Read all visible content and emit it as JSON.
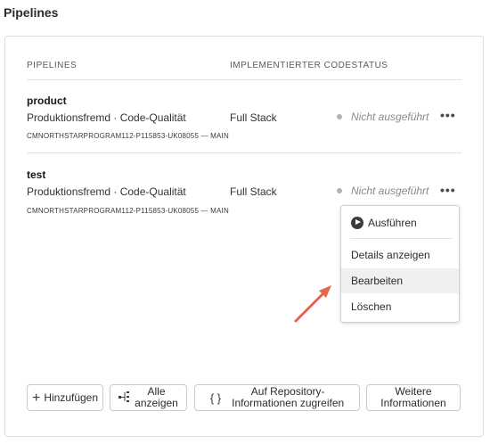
{
  "page": {
    "title": "Pipelines"
  },
  "table": {
    "headers": [
      "PIPELINES",
      "IMPLEMENTIERTER CODESTATUS"
    ],
    "rows": [
      {
        "name": "product",
        "type": "Produktionsfremd · Code-Qualität",
        "repo": "CMNORTHSTARPROGRAM112-P115853-UK08055 — MAIN",
        "stack": "Full Stack",
        "status": "Nicht ausgeführt",
        "more": "•••"
      },
      {
        "name": "test",
        "type": "Produktionsfremd · Code-Qualität",
        "repo": "CMNORTHSTARPROGRAM112-P115853-UK08055 — MAIN",
        "stack": "Full Stack",
        "status": "Nicht ausgeführt",
        "more": "•••"
      }
    ]
  },
  "menu": {
    "items": [
      "Ausführen",
      "Details anzeigen",
      "Bearbeiten",
      "Löschen"
    ],
    "hovered": "Bearbeiten"
  },
  "buttons": {
    "add": {
      "icon": "plus-icon",
      "glyph": "+",
      "label": "Hinzufügen"
    },
    "show_all": {
      "icon": "pipeline-tree-icon",
      "glyph": "▪⋮",
      "line1": "Alle",
      "line2": "anzeigen"
    },
    "repo_info": {
      "icon": "braces-icon",
      "glyph": "{ }",
      "line1": "Auf Repository-",
      "line2": "Informationen zugreifen"
    },
    "more_info": {
      "line1": "Weitere",
      "line2": "Informationen"
    }
  },
  "colors": {
    "annotation_arrow": "#e8654a",
    "status_dot": "#b3b3b3",
    "hover_bg": "#f0f0f0"
  }
}
